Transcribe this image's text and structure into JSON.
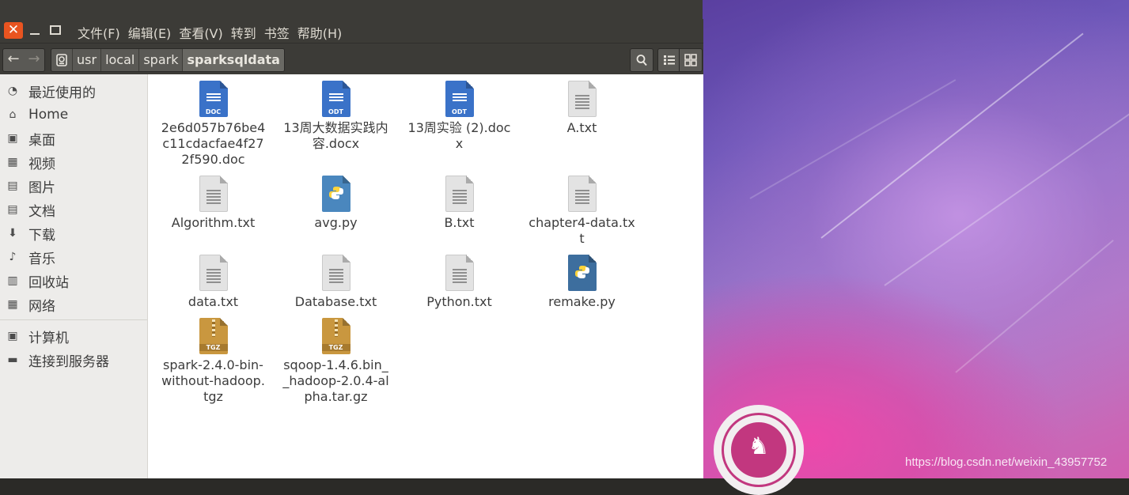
{
  "menu": [
    "文件(F)",
    "编辑(E)",
    "查看(V)",
    "转到",
    "书签",
    "帮助(H)"
  ],
  "window_controls": {
    "close": "✕"
  },
  "breadcrumbs": [
    "usr",
    "local",
    "spark",
    "sparksqldata"
  ],
  "sidebar": {
    "items": [
      {
        "label": "最近使用的",
        "icon": "clock-icon"
      },
      {
        "label": "Home",
        "icon": "home-icon"
      },
      {
        "label": "桌面",
        "icon": "desktop-icon"
      },
      {
        "label": "视频",
        "icon": "video-icon"
      },
      {
        "label": "图片",
        "icon": "picture-icon"
      },
      {
        "label": "文档",
        "icon": "document-icon"
      },
      {
        "label": "下载",
        "icon": "download-icon"
      },
      {
        "label": "音乐",
        "icon": "music-icon"
      },
      {
        "label": "回收站",
        "icon": "trash-icon"
      },
      {
        "label": "网络",
        "icon": "network-icon"
      }
    ],
    "devices": [
      {
        "label": "计算机",
        "icon": "computer-icon"
      },
      {
        "label": "连接到服务器",
        "icon": "server-icon"
      }
    ]
  },
  "files": [
    {
      "name": "2e6d057b76be4c11cdacfae4f272f590.doc",
      "type": "doc",
      "tag": "DOC"
    },
    {
      "name": "13周大数据实践内容.docx",
      "type": "odt",
      "tag": "ODT"
    },
    {
      "name": "13周实验 (2).docx",
      "type": "odt",
      "tag": "ODT"
    },
    {
      "name": "A.txt",
      "type": "txt"
    },
    {
      "name": "Algorithm.txt",
      "type": "txt"
    },
    {
      "name": "avg.py",
      "type": "py"
    },
    {
      "name": "B.txt",
      "type": "txt"
    },
    {
      "name": "chapter4-data.txt",
      "type": "txt"
    },
    {
      "name": "data.txt",
      "type": "txt"
    },
    {
      "name": "Database.txt",
      "type": "txt"
    },
    {
      "name": "Python.txt",
      "type": "txt"
    },
    {
      "name": "remake.py",
      "type": "py"
    },
    {
      "name": "spark-2.4.0-bin-without-hadoop.tgz",
      "type": "tgz",
      "tag": "TGZ"
    },
    {
      "name": "sqoop-1.4.6.bin__hadoop-2.0.4-alpha.tar.gz",
      "type": "tgz",
      "tag": "TGZ"
    }
  ],
  "watermark": "https://blog.csdn.net/weixin_43957752",
  "colors": {
    "accent": "#e95420",
    "doc_blue": "#3a72c8",
    "python_blue": "#3d6e9e",
    "archive": "#c9973f"
  }
}
